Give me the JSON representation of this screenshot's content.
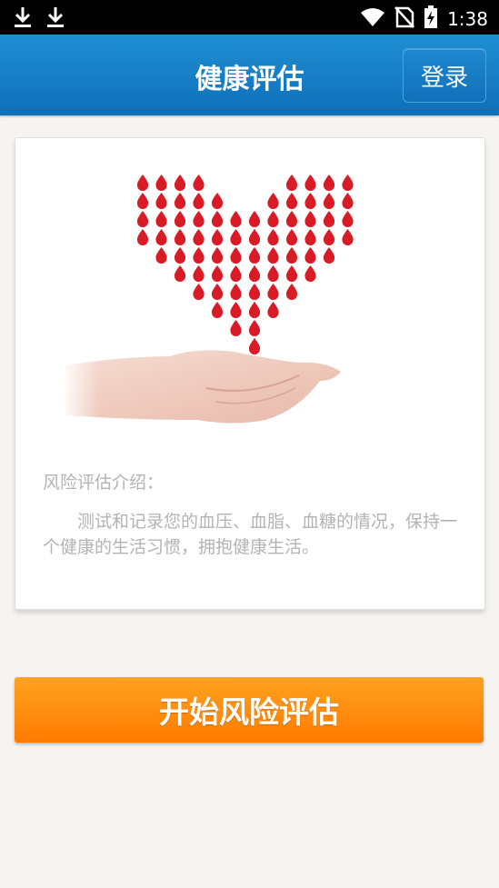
{
  "status_bar": {
    "time": "1:38",
    "icons": [
      "download-icon",
      "download-icon",
      "wifi-icon",
      "no-sim-icon",
      "battery-charging-icon"
    ]
  },
  "header": {
    "title": "健康评估",
    "login_label": "登录"
  },
  "card": {
    "illustration": "heart-of-drops-in-hands",
    "intro_title": "风险评估介绍：",
    "intro_body": "测试和记录您的血压、血脂、血糖的情况，保持一个健康的生活习惯，拥抱健康生活。"
  },
  "actions": {
    "start_label": "开始风险评估"
  },
  "colors": {
    "header_blue": "#1a85cc",
    "button_orange": "#ff8a00",
    "drop_red": "#d81b25",
    "muted_text": "#b3b3b3"
  }
}
